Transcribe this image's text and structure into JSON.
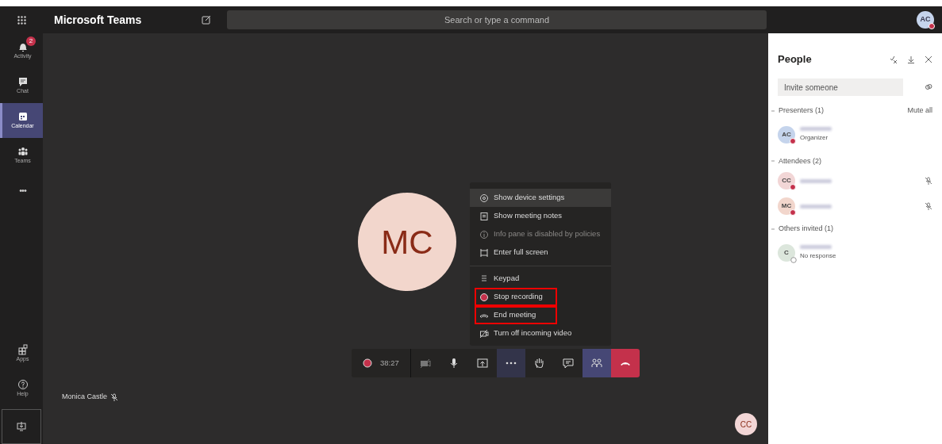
{
  "window": {
    "title": "Microsoft Teams"
  },
  "search": {
    "placeholder": "Search or type a command"
  },
  "user_avatar": {
    "initials": "AC",
    "color": "#c4314b"
  },
  "rail": {
    "items": [
      {
        "kind": "activity",
        "label": "Activity",
        "badge": "2",
        "selected": false
      },
      {
        "kind": "chat",
        "label": "Chat",
        "selected": false
      },
      {
        "kind": "calendar",
        "label": "Calendar",
        "selected": true
      },
      {
        "kind": "teams",
        "label": "Teams",
        "selected": false
      },
      {
        "kind": "more",
        "label": "•••",
        "selected": false
      }
    ],
    "bottom_items": [
      {
        "kind": "apps",
        "label": "Apps"
      },
      {
        "kind": "help",
        "label": "Help"
      },
      {
        "kind": "download"
      }
    ]
  },
  "stage": {
    "avatar": "MC",
    "participant_label": "Monica Castle",
    "self_avatar": "CC"
  },
  "menu": {
    "items": [
      {
        "kind": "gear",
        "label": "Show device settings",
        "disabled": false,
        "hovered": true,
        "highlighted": false,
        "divider_before": false
      },
      {
        "kind": "notes",
        "label": "Show meeting notes",
        "disabled": false,
        "hovered": false,
        "highlighted": false,
        "divider_before": false
      },
      {
        "kind": "info",
        "label": "Info pane is disabled by policies",
        "disabled": true,
        "hovered": false,
        "highlighted": false,
        "divider_before": false
      },
      {
        "kind": "fullscreen",
        "label": "Enter full screen",
        "disabled": false,
        "hovered": false,
        "highlighted": false,
        "divider_before": false
      },
      {
        "kind": "keypad",
        "label": "Keypad",
        "disabled": false,
        "hovered": false,
        "highlighted": false,
        "divider_before": true
      },
      {
        "kind": "record",
        "label": "Stop recording",
        "disabled": false,
        "hovered": false,
        "highlighted": true,
        "divider_before": false
      },
      {
        "kind": "end",
        "label": "End meeting",
        "disabled": false,
        "hovered": false,
        "highlighted": true,
        "divider_before": false
      },
      {
        "kind": "video",
        "label": "Turn off incoming video",
        "disabled": false,
        "hovered": false,
        "highlighted": false,
        "divider_before": false
      }
    ]
  },
  "call_bar": {
    "timer": "38:27",
    "buttons": [
      {
        "kind": "camera-off",
        "selected": false
      },
      {
        "kind": "mic",
        "selected": false
      },
      {
        "kind": "share",
        "selected": false
      },
      {
        "kind": "more",
        "selected": true
      },
      {
        "kind": "hand",
        "selected": false
      },
      {
        "kind": "chat",
        "selected": false
      },
      {
        "kind": "people",
        "selected": true
      },
      {
        "kind": "hangup",
        "selected": false
      }
    ]
  },
  "people_panel": {
    "title": "People",
    "invite_placeholder": "Invite someone",
    "groups": [
      {
        "title": "Presenters (1)",
        "action": "Mute all",
        "people": [
          {
            "initials": "AC",
            "color": "#c5d4ec",
            "subtitle": "Organizer",
            "busy": true,
            "muted": false
          }
        ]
      },
      {
        "title": "Attendees (2)",
        "people": [
          {
            "initials": "CC",
            "color": "#f2d6d6",
            "busy": true,
            "muted": true
          },
          {
            "initials": "MC",
            "color": "#f2d6cc",
            "busy": true,
            "muted": true
          }
        ]
      },
      {
        "title": "Others invited (1)",
        "people": [
          {
            "initials": "C",
            "color": "#dce6dc",
            "subtitle": "No response",
            "busy": false,
            "muted": false
          }
        ]
      }
    ]
  }
}
